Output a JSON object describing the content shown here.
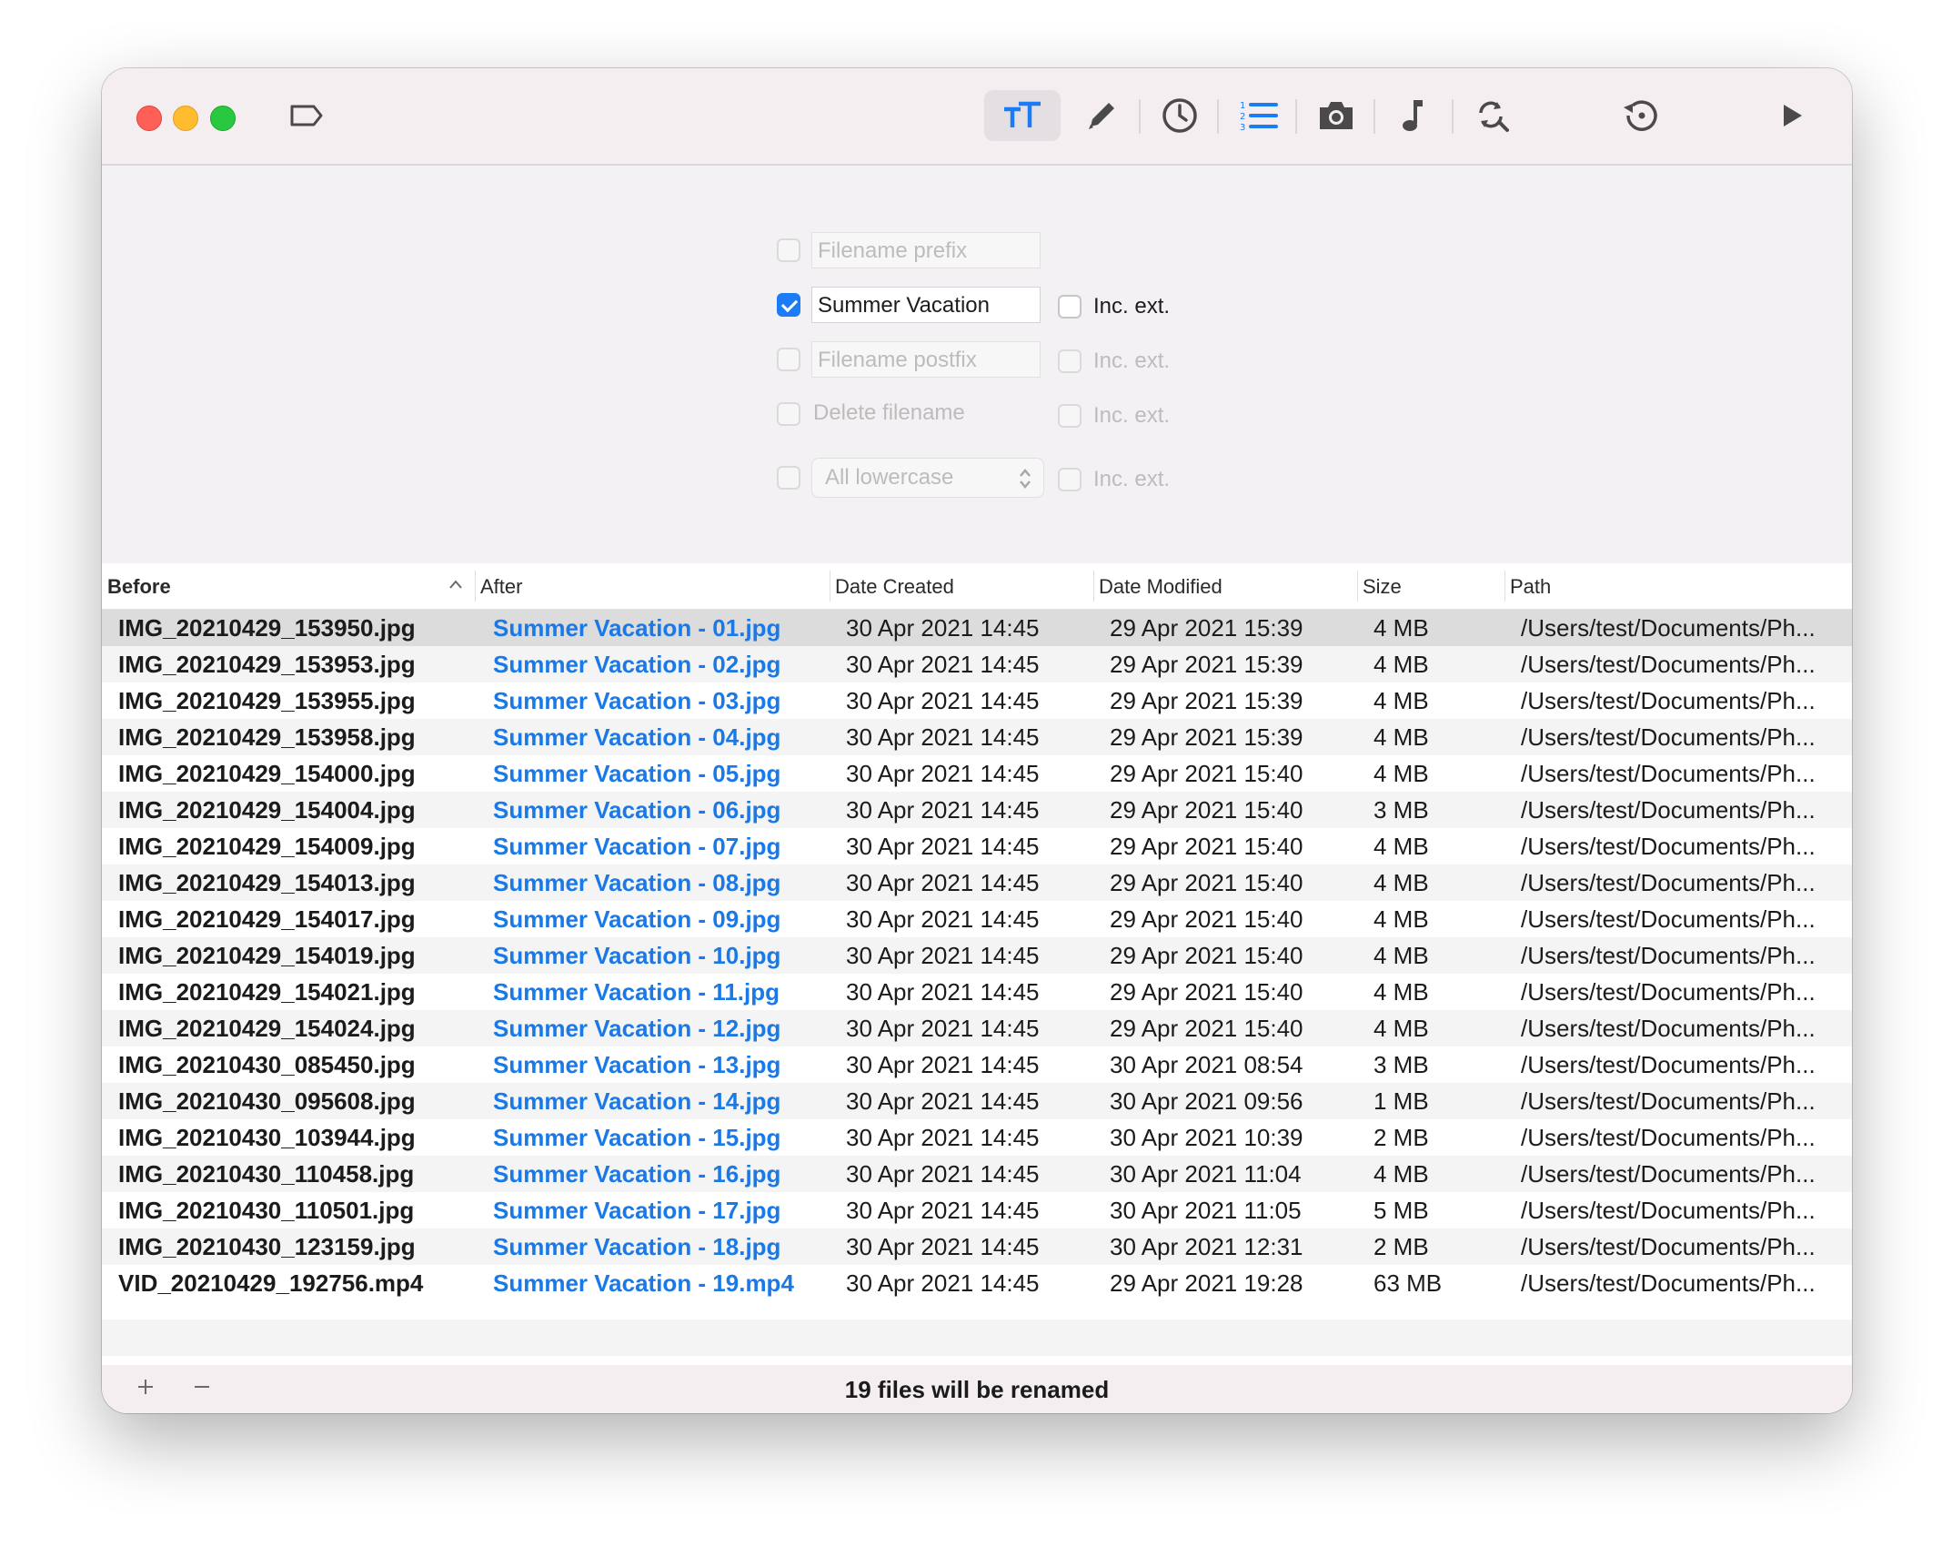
{
  "toolbar": {
    "items": [
      {
        "name": "text-case-icon",
        "selected": true
      },
      {
        "name": "pencil-icon",
        "selected": false
      },
      {
        "name": "clock-icon",
        "selected": false
      },
      {
        "name": "numbered-list-icon",
        "selected": false
      },
      {
        "name": "camera-icon",
        "selected": false
      },
      {
        "name": "music-note-icon",
        "selected": false
      },
      {
        "name": "find-replace-icon",
        "selected": false
      },
      {
        "name": "revert-icon",
        "selected": false
      },
      {
        "name": "play-icon",
        "selected": false
      }
    ]
  },
  "options": {
    "prefix": {
      "checked": false,
      "placeholder": "Filename prefix"
    },
    "new_name": {
      "checked": true,
      "value": "Summer Vacation",
      "inc_ext_label": "Inc. ext.",
      "inc_ext_checked": false
    },
    "postfix": {
      "checked": false,
      "placeholder": "Filename postfix",
      "inc_ext_label": "Inc. ext."
    },
    "delete": {
      "checked": false,
      "label": "Delete filename",
      "inc_ext_label": "Inc. ext."
    },
    "case": {
      "checked": false,
      "selected": "All lowercase",
      "inc_ext_label": "Inc. ext."
    }
  },
  "table": {
    "columns": {
      "before": "Before",
      "after": "After",
      "created": "Date Created",
      "modified": "Date Modified",
      "size": "Size",
      "path": "Path"
    },
    "sort_column": "before",
    "rows": [
      {
        "before": "IMG_20210429_153950.jpg",
        "after": "Summer Vacation - 01.jpg",
        "created": "30 Apr 2021 14:45",
        "modified": "29 Apr 2021 15:39",
        "size": "4 MB",
        "path": "/Users/test/Documents/Ph..."
      },
      {
        "before": "IMG_20210429_153953.jpg",
        "after": "Summer Vacation - 02.jpg",
        "created": "30 Apr 2021 14:45",
        "modified": "29 Apr 2021 15:39",
        "size": "4 MB",
        "path": "/Users/test/Documents/Ph..."
      },
      {
        "before": "IMG_20210429_153955.jpg",
        "after": "Summer Vacation - 03.jpg",
        "created": "30 Apr 2021 14:45",
        "modified": "29 Apr 2021 15:39",
        "size": "4 MB",
        "path": "/Users/test/Documents/Ph..."
      },
      {
        "before": "IMG_20210429_153958.jpg",
        "after": "Summer Vacation - 04.jpg",
        "created": "30 Apr 2021 14:45",
        "modified": "29 Apr 2021 15:39",
        "size": "4 MB",
        "path": "/Users/test/Documents/Ph..."
      },
      {
        "before": "IMG_20210429_154000.jpg",
        "after": "Summer Vacation - 05.jpg",
        "created": "30 Apr 2021 14:45",
        "modified": "29 Apr 2021 15:40",
        "size": "4 MB",
        "path": "/Users/test/Documents/Ph..."
      },
      {
        "before": "IMG_20210429_154004.jpg",
        "after": "Summer Vacation - 06.jpg",
        "created": "30 Apr 2021 14:45",
        "modified": "29 Apr 2021 15:40",
        "size": "3 MB",
        "path": "/Users/test/Documents/Ph..."
      },
      {
        "before": "IMG_20210429_154009.jpg",
        "after": "Summer Vacation - 07.jpg",
        "created": "30 Apr 2021 14:45",
        "modified": "29 Apr 2021 15:40",
        "size": "4 MB",
        "path": "/Users/test/Documents/Ph..."
      },
      {
        "before": "IMG_20210429_154013.jpg",
        "after": "Summer Vacation - 08.jpg",
        "created": "30 Apr 2021 14:45",
        "modified": "29 Apr 2021 15:40",
        "size": "4 MB",
        "path": "/Users/test/Documents/Ph..."
      },
      {
        "before": "IMG_20210429_154017.jpg",
        "after": "Summer Vacation - 09.jpg",
        "created": "30 Apr 2021 14:45",
        "modified": "29 Apr 2021 15:40",
        "size": "4 MB",
        "path": "/Users/test/Documents/Ph..."
      },
      {
        "before": "IMG_20210429_154019.jpg",
        "after": "Summer Vacation - 10.jpg",
        "created": "30 Apr 2021 14:45",
        "modified": "29 Apr 2021 15:40",
        "size": "4 MB",
        "path": "/Users/test/Documents/Ph..."
      },
      {
        "before": "IMG_20210429_154021.jpg",
        "after": "Summer Vacation - 11.jpg",
        "created": "30 Apr 2021 14:45",
        "modified": "29 Apr 2021 15:40",
        "size": "4 MB",
        "path": "/Users/test/Documents/Ph..."
      },
      {
        "before": "IMG_20210429_154024.jpg",
        "after": "Summer Vacation - 12.jpg",
        "created": "30 Apr 2021 14:45",
        "modified": "29 Apr 2021 15:40",
        "size": "4 MB",
        "path": "/Users/test/Documents/Ph..."
      },
      {
        "before": "IMG_20210430_085450.jpg",
        "after": "Summer Vacation - 13.jpg",
        "created": "30 Apr 2021 14:45",
        "modified": "30 Apr 2021 08:54",
        "size": "3 MB",
        "path": "/Users/test/Documents/Ph..."
      },
      {
        "before": "IMG_20210430_095608.jpg",
        "after": "Summer Vacation - 14.jpg",
        "created": "30 Apr 2021 14:45",
        "modified": "30 Apr 2021 09:56",
        "size": "1 MB",
        "path": "/Users/test/Documents/Ph..."
      },
      {
        "before": "IMG_20210430_103944.jpg",
        "after": "Summer Vacation - 15.jpg",
        "created": "30 Apr 2021 14:45",
        "modified": "30 Apr 2021 10:39",
        "size": "2 MB",
        "path": "/Users/test/Documents/Ph..."
      },
      {
        "before": "IMG_20210430_110458.jpg",
        "after": "Summer Vacation - 16.jpg",
        "created": "30 Apr 2021 14:45",
        "modified": "30 Apr 2021 11:04",
        "size": "4 MB",
        "path": "/Users/test/Documents/Ph..."
      },
      {
        "before": "IMG_20210430_110501.jpg",
        "after": "Summer Vacation - 17.jpg",
        "created": "30 Apr 2021 14:45",
        "modified": "30 Apr 2021 11:05",
        "size": "5 MB",
        "path": "/Users/test/Documents/Ph..."
      },
      {
        "before": "IMG_20210430_123159.jpg",
        "after": "Summer Vacation - 18.jpg",
        "created": "30 Apr 2021 14:45",
        "modified": "30 Apr 2021 12:31",
        "size": "2 MB",
        "path": "/Users/test/Documents/Ph..."
      },
      {
        "before": "VID_20210429_192756.mp4",
        "after": "Summer Vacation - 19.mp4",
        "created": "30 Apr 2021 14:45",
        "modified": "29 Apr 2021 19:28",
        "size": "63 MB",
        "path": "/Users/test/Documents/Ph..."
      }
    ]
  },
  "footer": {
    "add_label": "+",
    "remove_label": "−",
    "status": "19 files will be renamed"
  },
  "colors": {
    "accent": "#1b7cf5",
    "after_text": "#1a79e6",
    "selected_row": "#dcdcdc",
    "alt_row": "#f4f4f5"
  }
}
